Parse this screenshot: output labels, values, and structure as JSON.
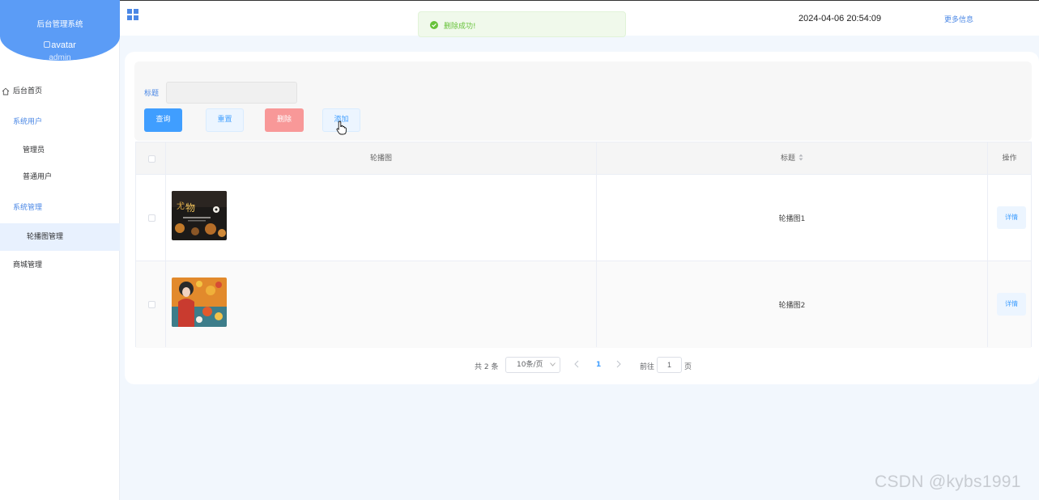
{
  "sidebar": {
    "app_title": "后台管理系统",
    "avatar_alt": "avatar",
    "username": "admin",
    "items": [
      {
        "label": "后台首页"
      },
      {
        "label": "系统用户"
      },
      {
        "label": "管理员"
      },
      {
        "label": "普通用户"
      },
      {
        "label": "系统管理"
      },
      {
        "label": "轮播图管理"
      },
      {
        "label": "商城管理"
      }
    ],
    "active_item": "轮播图管理"
  },
  "header": {
    "datetime": "2024-04-06 20:54:09",
    "more_link": "更多信息"
  },
  "toast": {
    "message": "删除成功!",
    "type": "success"
  },
  "search": {
    "label": "标题",
    "value": "",
    "buttons": {
      "query": "查询",
      "reset": "重置",
      "delete": "删除",
      "add": "添加"
    }
  },
  "table": {
    "columns": {
      "image": "轮播图",
      "title": "标题",
      "actions": "操作"
    },
    "rows": [
      {
        "title": "轮播图1",
        "action": "详情"
      },
      {
        "title": "轮播图2",
        "action": "详情"
      }
    ]
  },
  "pagination": {
    "total_text": "共 2 条",
    "page_size": "10条/页",
    "current_page": "1",
    "goto_label": "前往",
    "goto_value": "1",
    "goto_unit": "页"
  },
  "watermark": "CSDN @kybs1991",
  "colors": {
    "primary": "#409eff",
    "brand": "#5b9cf6",
    "danger": "#f89898",
    "success": "#67c23a"
  }
}
